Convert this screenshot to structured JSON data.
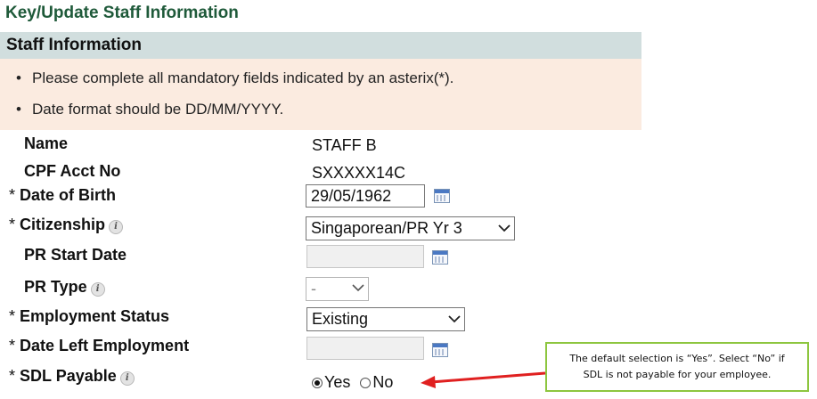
{
  "page": {
    "title": "Key/Update Staff Information"
  },
  "section": {
    "header": "Staff Information"
  },
  "notes": [
    "Please complete all mandatory fields indicated by an asterix(*).",
    "Date format should be DD/MM/YYYY."
  ],
  "fields": {
    "name": {
      "label": "Name",
      "value": "STAFF B"
    },
    "cpf_acct_no": {
      "label": "CPF Acct No",
      "value": "SXXXXX14C"
    },
    "date_of_birth": {
      "label": "Date of Birth",
      "required": "*",
      "value": "29/05/1962"
    },
    "citizenship": {
      "label": "Citizenship",
      "required": "*",
      "selected": "Singaporean/PR Yr 3"
    },
    "pr_start_date": {
      "label": "PR Start Date",
      "value": ""
    },
    "pr_type": {
      "label": "PR Type",
      "selected": "-"
    },
    "employment_status": {
      "label": "Employment Status",
      "required": "*",
      "selected": "Existing"
    },
    "date_left_employment": {
      "label": "Date Left Employment",
      "required": "*",
      "value": ""
    },
    "sdl_payable": {
      "label": "SDL Payable",
      "required": "*",
      "options": [
        "Yes",
        "No"
      ],
      "selected": "Yes"
    }
  },
  "callout": {
    "line1": "The default selection is “Yes”. Select “No” if",
    "line2": "SDL is not payable for your employee."
  },
  "icons": {
    "info": "info-icon",
    "calendar": "calendar-icon",
    "dropdown": "chevron-down-icon"
  },
  "colors": {
    "title": "#1f5a3a",
    "section_header_bg": "#d1dede",
    "notes_bg": "#fbebe0",
    "callout_border": "#8dc63f",
    "arrow": "#e02020"
  }
}
